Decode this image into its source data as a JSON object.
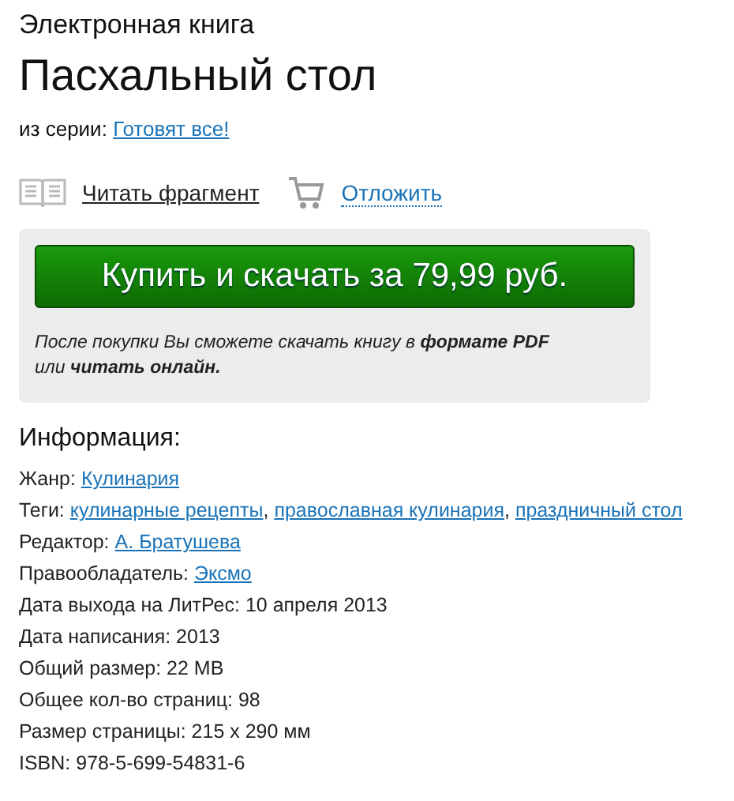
{
  "type_label": "Электронная книга",
  "title": "Пасхальный стол",
  "series": {
    "label": "из серии:",
    "link": "Готовят все!"
  },
  "actions": [
    {
      "kind": "read",
      "label": "Читать фрагмент"
    },
    {
      "kind": "defer",
      "label": "Отложить"
    }
  ],
  "buy": {
    "button": "Купить и скачать за 79,99 руб.",
    "note": "После покупки Вы сможете скачать книгу в **формате PDF** или **читать онлайн.**"
  },
  "info": {
    "heading": "Информация:",
    "rows": [
      {
        "kind": "links",
        "label": "Жанр:",
        "links": [
          "Кулинария"
        ]
      },
      {
        "kind": "links",
        "label": "Теги:",
        "links": [
          "кулинарные рецепты",
          "православная кулинария",
          "праздничный стол"
        ],
        "separator": ","
      },
      {
        "kind": "links",
        "label": "Редактор:",
        "links": [
          "А. Братушева"
        ]
      },
      {
        "kind": "links",
        "label": "Правообладатель:",
        "links": [
          "Эксмо"
        ]
      },
      {
        "kind": "text",
        "text": "Дата выхода на ЛитРес: 10 апреля 2013"
      },
      {
        "kind": "text",
        "text": "Дата написания: 2013"
      },
      {
        "kind": "text",
        "text": "Общий размер: 22 MB"
      },
      {
        "kind": "text",
        "text": "Общее кол-во страниц: 98"
      },
      {
        "kind": "text",
        "text": "Размер страницы: 215 x 290 мм"
      },
      {
        "kind": "text",
        "text": "ISBN: 978-5-699-54831-6"
      }
    ]
  }
}
